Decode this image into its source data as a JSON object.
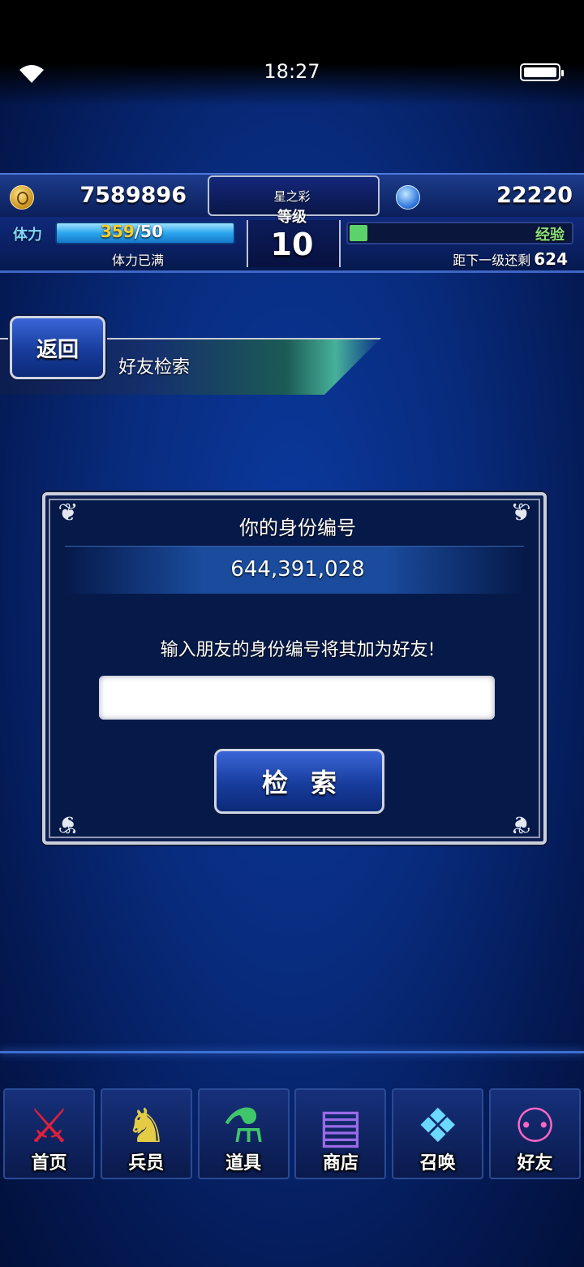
{
  "status_bar": {
    "time": "18:27"
  },
  "hud": {
    "gil": "7589896",
    "lapis": "22220",
    "stamina_label": "体力",
    "stamina_current": "359",
    "stamina_max": "/50",
    "stamina_status": "体力已满",
    "rank_name": "星之彩",
    "level_label": "等级",
    "level": "10",
    "exp_label": "经验",
    "exp_next_text": "距下一级还剩",
    "exp_next_value": "624",
    "exp_fill_fraction": 0.08
  },
  "header": {
    "back_label": "返回",
    "page_title": "好友检索"
  },
  "panel": {
    "title": "你的身份编号",
    "id_value": "644,391,028",
    "prompt": "输入朋友的身份编号将其加为好友!",
    "input_value": "",
    "search_label": "检索"
  },
  "nav": [
    {
      "label": "首页",
      "icon": "sword-icon"
    },
    {
      "label": "兵员",
      "icon": "unit-icon"
    },
    {
      "label": "道具",
      "icon": "potion-icon"
    },
    {
      "label": "商店",
      "icon": "shop-icon"
    },
    {
      "label": "召唤",
      "icon": "crystal-icon"
    },
    {
      "label": "好友",
      "icon": "friends-icon"
    }
  ],
  "colors": {
    "stamina": "#ffcc2a",
    "exp": "#5cd36a",
    "background": "#082a7a"
  }
}
